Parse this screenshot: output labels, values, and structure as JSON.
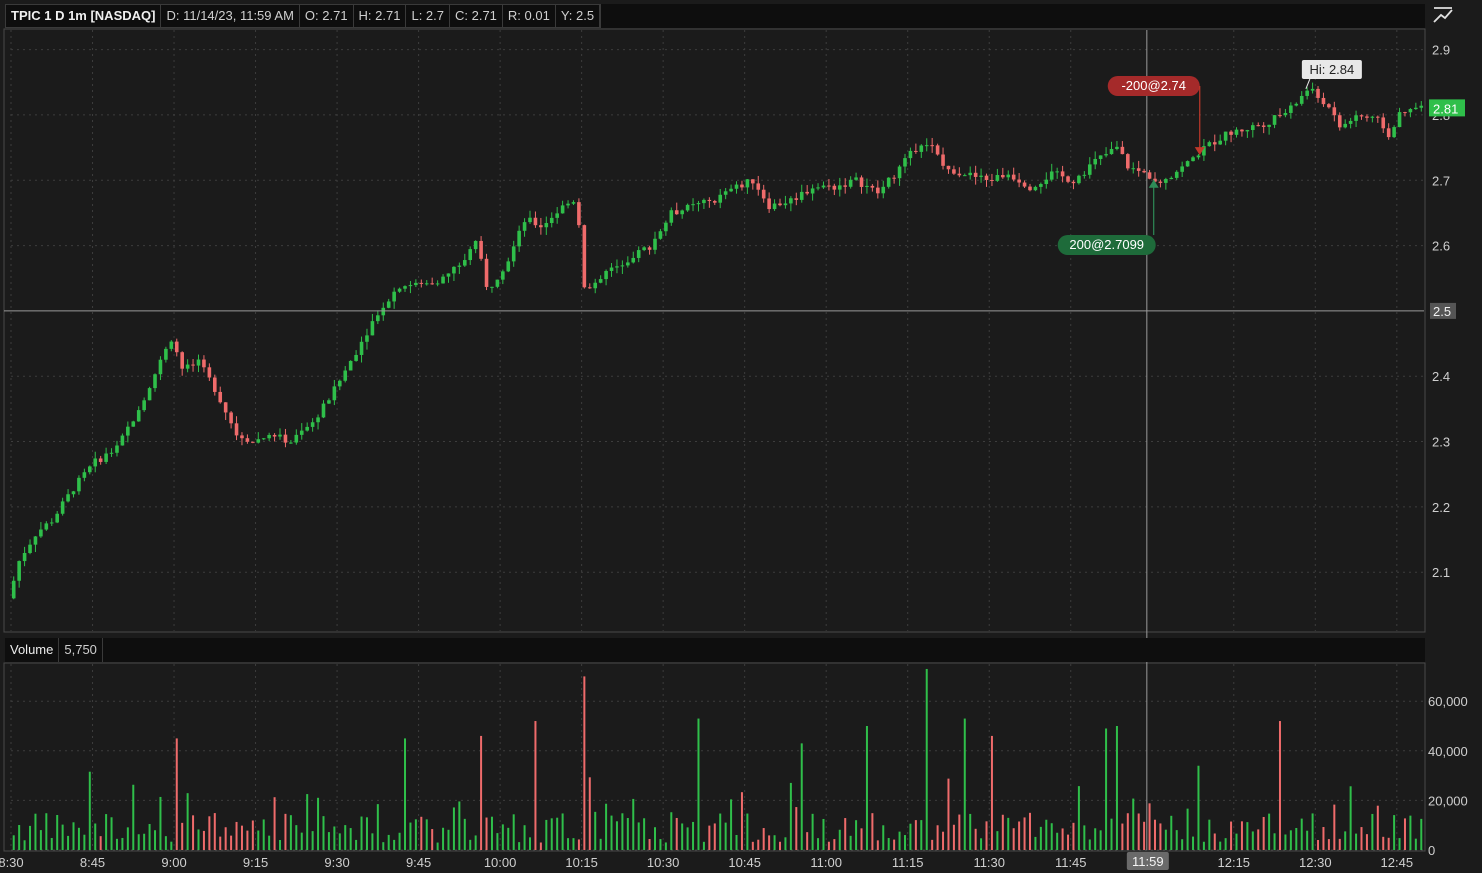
{
  "header": {
    "symbol": "TPIC 1 D 1m [NASDAQ]",
    "date": "D: 11/14/23, 11:59 AM",
    "open": "O: 2.71",
    "high": "H: 2.71",
    "low": "L: 2.7",
    "close": "C: 2.71",
    "range": "R: 0.01",
    "cursor_y": "Y: 2.5"
  },
  "volume_header": {
    "title": "Volume",
    "value": "5,750"
  },
  "colors": {
    "up": "#2fbf4a",
    "down": "#ef6b6b",
    "grid": "#3d3d3d",
    "crosshair": "#9a9a9a",
    "background": "#1b1b1b"
  },
  "icons": {
    "top_right": "chart-style-icon"
  },
  "chart_data": [
    {
      "type": "candlestick",
      "title": "TPIC 1 D 1m [NASDAQ]",
      "x_ticks": [
        "8:30",
        "8:45",
        "9:00",
        "9:15",
        "9:30",
        "9:45",
        "10:00",
        "10:15",
        "10:30",
        "10:45",
        "11:00",
        "11:15",
        "11:30",
        "11:45",
        "12:15",
        "12:30",
        "12:45"
      ],
      "x_tick_minutes": [
        0,
        15,
        30,
        45,
        60,
        75,
        90,
        105,
        120,
        135,
        150,
        165,
        180,
        195,
        225,
        240,
        255
      ],
      "y_ticks": [
        "2.9",
        "2.8",
        "2.7",
        "2.6",
        "2.4",
        "2.3",
        "2.2",
        "2.1"
      ],
      "ylim": [
        2.01,
        2.93
      ],
      "xlim_minutes": [
        0,
        260
      ],
      "last_price_label": "2.81",
      "cursor_price_label": "2.5",
      "cursor_time_label": "11:59",
      "annotations": [
        {
          "text": "Hi: 2.84",
          "minute": 239,
          "price": 2.84
        },
        {
          "text": "-200@2.74",
          "minute": 218,
          "price": 2.74,
          "side": "sell"
        },
        {
          "text": "200@2.7099",
          "minute": 211,
          "price": 2.7099,
          "side": "buy"
        }
      ],
      "price_path": [
        [
          0,
          2.06
        ],
        [
          2,
          2.12
        ],
        [
          5,
          2.16
        ],
        [
          8,
          2.18
        ],
        [
          12,
          2.23
        ],
        [
          16,
          2.27
        ],
        [
          20,
          2.29
        ],
        [
          25,
          2.37
        ],
        [
          30,
          2.46
        ],
        [
          32,
          2.41
        ],
        [
          35,
          2.42
        ],
        [
          38,
          2.38
        ],
        [
          42,
          2.31
        ],
        [
          45,
          2.3
        ],
        [
          48,
          2.31
        ],
        [
          52,
          2.3
        ],
        [
          56,
          2.33
        ],
        [
          60,
          2.38
        ],
        [
          64,
          2.44
        ],
        [
          68,
          2.5
        ],
        [
          72,
          2.54
        ],
        [
          76,
          2.54
        ],
        [
          80,
          2.55
        ],
        [
          84,
          2.58
        ],
        [
          86,
          2.61
        ],
        [
          88,
          2.53
        ],
        [
          92,
          2.58
        ],
        [
          95,
          2.64
        ],
        [
          98,
          2.63
        ],
        [
          102,
          2.66
        ],
        [
          104,
          2.67
        ],
        [
          105,
          2.63
        ],
        [
          106,
          2.53
        ],
        [
          110,
          2.56
        ],
        [
          114,
          2.58
        ],
        [
          118,
          2.6
        ],
        [
          122,
          2.65
        ],
        [
          126,
          2.66
        ],
        [
          130,
          2.67
        ],
        [
          134,
          2.69
        ],
        [
          137,
          2.7
        ],
        [
          140,
          2.66
        ],
        [
          144,
          2.67
        ],
        [
          148,
          2.69
        ],
        [
          152,
          2.69
        ],
        [
          156,
          2.7
        ],
        [
          160,
          2.68
        ],
        [
          164,
          2.72
        ],
        [
          168,
          2.76
        ],
        [
          170,
          2.75
        ],
        [
          172,
          2.72
        ],
        [
          176,
          2.71
        ],
        [
          180,
          2.7
        ],
        [
          184,
          2.71
        ],
        [
          188,
          2.69
        ],
        [
          192,
          2.71
        ],
        [
          196,
          2.7
        ],
        [
          200,
          2.73
        ],
        [
          204,
          2.75
        ],
        [
          206,
          2.72
        ],
        [
          209,
          2.71
        ],
        [
          212,
          2.7
        ],
        [
          216,
          2.72
        ],
        [
          220,
          2.75
        ],
        [
          224,
          2.77
        ],
        [
          228,
          2.78
        ],
        [
          232,
          2.79
        ],
        [
          236,
          2.81
        ],
        [
          239,
          2.84
        ],
        [
          242,
          2.82
        ],
        [
          245,
          2.78
        ],
        [
          248,
          2.8
        ],
        [
          252,
          2.79
        ],
        [
          254,
          2.77
        ],
        [
          256,
          2.8
        ],
        [
          259,
          2.81
        ]
      ]
    },
    {
      "type": "bar",
      "title": "Volume",
      "current_value": "5,750",
      "y_ticks": [
        "60,000",
        "40,000",
        "20,000",
        "0"
      ],
      "ylim": [
        0,
        75000
      ],
      "x_ticks": [
        "8:30",
        "8:45",
        "9:00",
        "9:15",
        "9:30",
        "9:45",
        "10:00",
        "10:15",
        "10:30",
        "10:45",
        "11:00",
        "11:15",
        "11:30",
        "11:45",
        "12:15",
        "12:30",
        "12:45"
      ],
      "spikes": [
        [
          105,
          70000
        ],
        [
          168,
          73000
        ],
        [
          126,
          53000
        ],
        [
          96,
          52000
        ],
        [
          157,
          50000
        ],
        [
          175,
          53000
        ],
        [
          233,
          52000
        ],
        [
          30,
          45000
        ],
        [
          72,
          45000
        ],
        [
          86,
          46000
        ],
        [
          145,
          43000
        ],
        [
          201,
          49000
        ],
        [
          180,
          46000
        ],
        [
          203,
          50000
        ]
      ]
    }
  ]
}
